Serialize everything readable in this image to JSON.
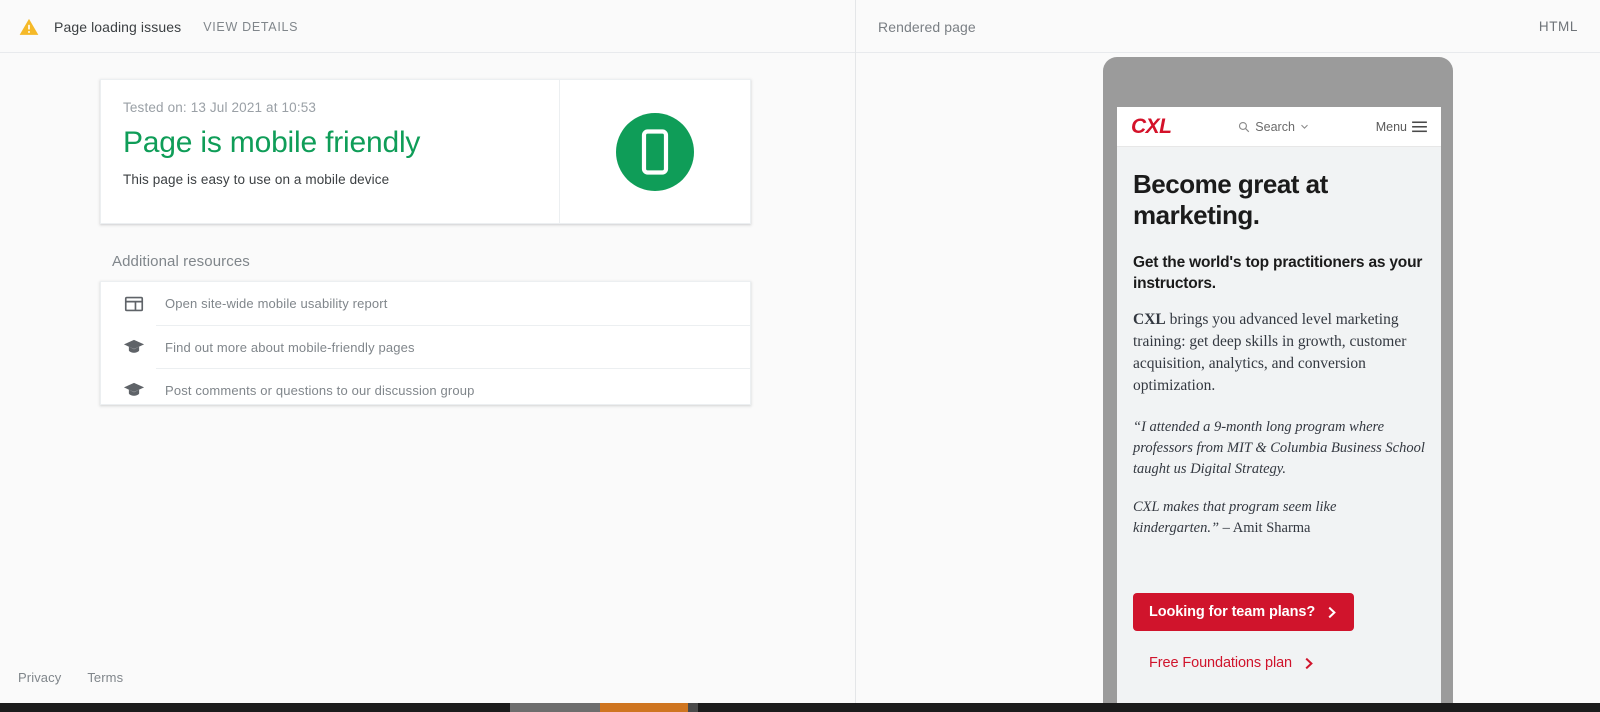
{
  "topbar": {
    "issues_label": "Page loading issues",
    "view_details": "VIEW DETAILS",
    "warning_icon": "warning-triangle-icon",
    "rendered_page_label": "Rendered page",
    "html_label": "HTML"
  },
  "result": {
    "tested_on": "Tested on: 13 Jul 2021 at 10:53",
    "verdict": "Page is mobile friendly",
    "verdict_sub": "This page is easy to use on a mobile device",
    "status_icon": "mobile-friendly-icon",
    "status_color": "#0f9d58"
  },
  "additional": {
    "title": "Additional resources",
    "items": [
      {
        "icon": "report-dashboard-icon",
        "label": "Open site-wide mobile usability report"
      },
      {
        "icon": "graduation-cap-icon",
        "label": "Find out more about mobile-friendly pages"
      },
      {
        "icon": "graduation-cap-icon",
        "label": "Post comments or questions to our discussion group"
      }
    ]
  },
  "footer": {
    "privacy": "Privacy",
    "terms": "Terms"
  },
  "preview": {
    "brand": "CXL",
    "brand_color": "#d4122a",
    "search_label": "Search",
    "menu_label": "Menu",
    "hero_heading": "Become great at marketing.",
    "hero_subheading": "Get the world's top practitioners as your instructors.",
    "body_lead": "CXL",
    "body_text": " brings you advanced level marketing training: get deep skills in growth, customer acquisition, analytics, and conversion optimization.",
    "quote_1": "“I attended a 9-month long program where professors from MIT & Columbia Business School taught us Digital Strategy.",
    "quote_2_italic": "CXL makes that program seem like kindergarten.” –",
    "quote_2_author": " Amit Sharma",
    "cta_primary": "Looking for team plans?",
    "cta_secondary": "Free Foundations plan",
    "cta_primary_color": "#d0142c"
  }
}
